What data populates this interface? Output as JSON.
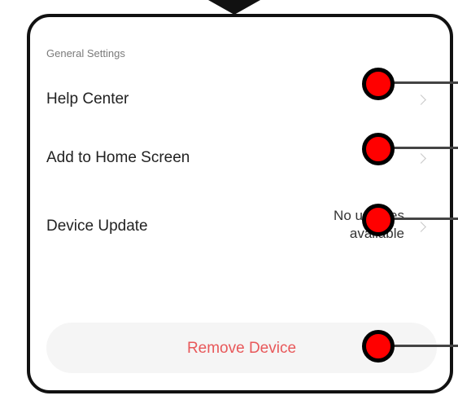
{
  "general_settings": {
    "section_title": "General Settings",
    "items": [
      {
        "label": "Help Center",
        "value": ""
      },
      {
        "label": "Add to Home Screen",
        "value": ""
      },
      {
        "label": "Device Update",
        "value": "No updates\navailable"
      }
    ]
  },
  "remove_button": {
    "label": "Remove Device"
  },
  "colors": {
    "accent_red": "#e8585a",
    "callout_red": "#ff0000",
    "frame": "#111111"
  },
  "icons": [
    "chevron-right-icon"
  ]
}
